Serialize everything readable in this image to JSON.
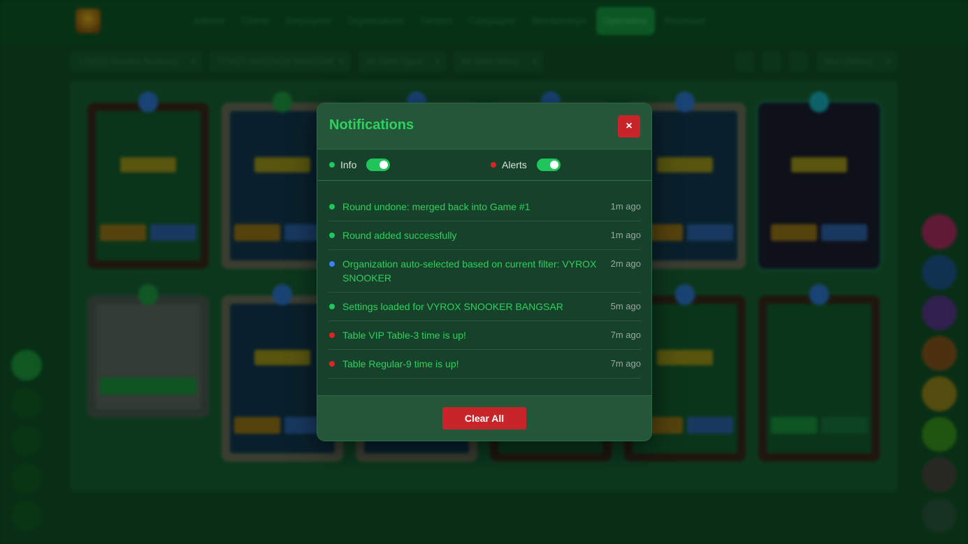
{
  "nav": {
    "items": [
      "Admins",
      "Clients",
      "Employees",
      "Organisations",
      "Centers",
      "Campaigns",
      "Memberships",
      "Operations",
      "Revenues"
    ],
    "active": "Operations"
  },
  "filters": {
    "academy": "VYROX Snooker Academy",
    "center": "VYROX SNOOKER BANGSAR",
    "table_type": "All Table Types",
    "table_status": "All Table Status",
    "user": "Alex (Admin)"
  },
  "notifications": {
    "title": "Notifications",
    "close_glyph": "×",
    "toggles": [
      {
        "label": "Info",
        "color": "#22c55e",
        "on": true
      },
      {
        "label": "Alerts",
        "color": "#dc2626",
        "on": true
      }
    ],
    "items": [
      {
        "text": "Round undone: merged back into Game #1",
        "time": "1m ago",
        "color": "#22c55e"
      },
      {
        "text": "Round added successfully",
        "time": "1m ago",
        "color": "#22c55e"
      },
      {
        "text": "Organization auto-selected based on current filter: VYROX SNOOKER",
        "time": "2m ago",
        "color": "#3b82f6"
      },
      {
        "text": "Settings loaded for VYROX SNOOKER BANGSAR",
        "time": "5m ago",
        "color": "#22c55e"
      },
      {
        "text": "Table VIP Table-3 time is up!",
        "time": "7m ago",
        "color": "#dc2626"
      },
      {
        "text": "Table Regular-9 time is up!",
        "time": "7m ago",
        "color": "#dc2626"
      }
    ],
    "clear_label": "Clear All"
  },
  "colors": {
    "accent_green": "#2fd05e",
    "danger_red": "#c8252a",
    "modal_bg": "#16412a"
  }
}
